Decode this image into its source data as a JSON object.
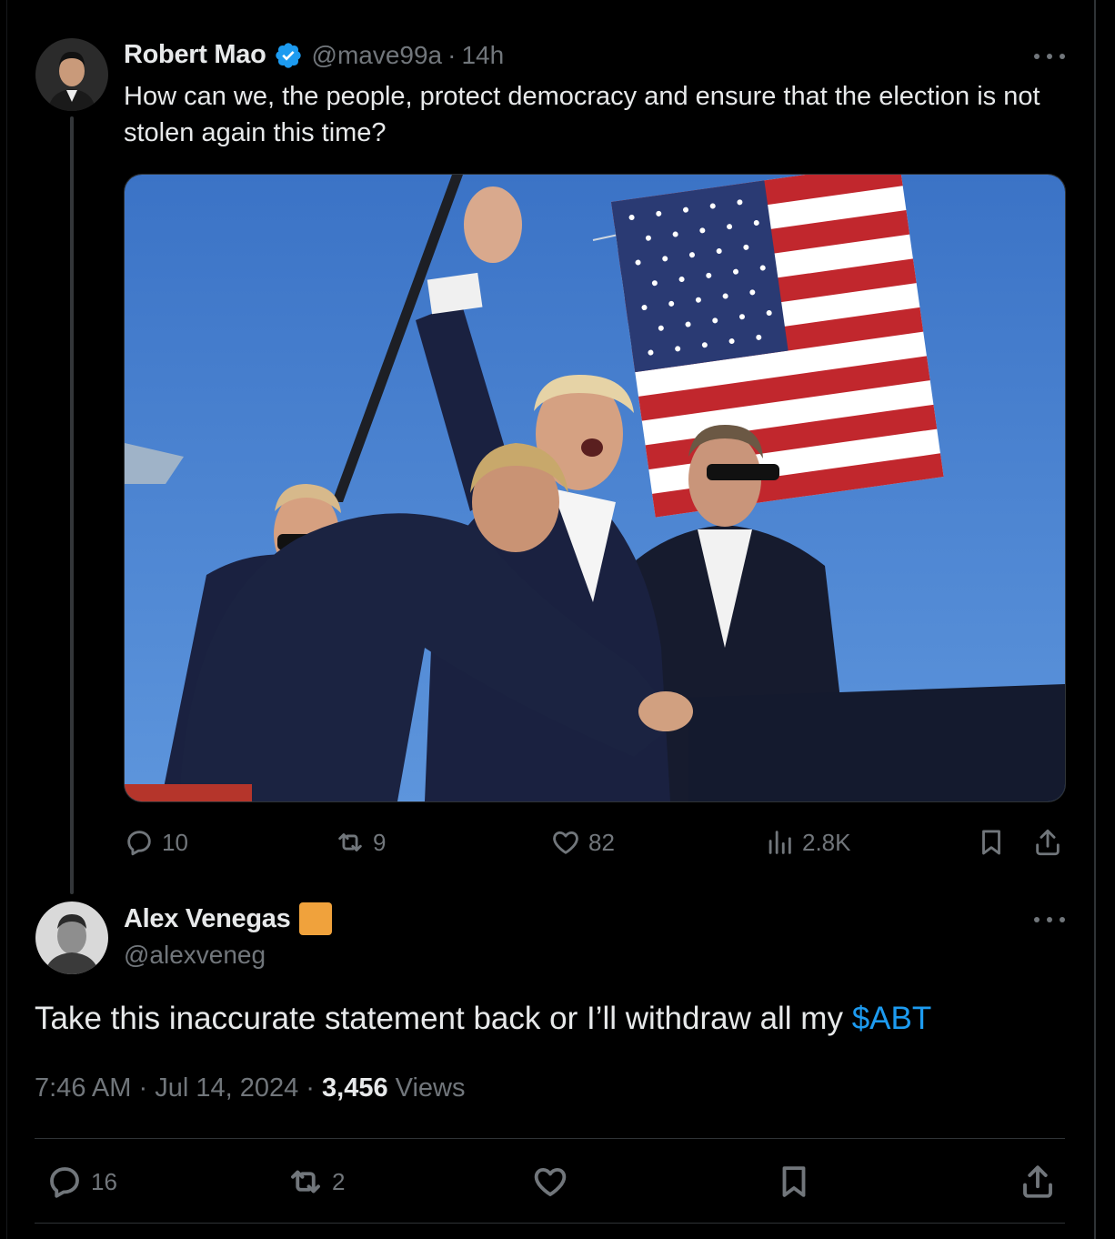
{
  "parent": {
    "author_name": "Robert Mao",
    "handle": "@mave99a",
    "separator": "·",
    "age": "14h",
    "text": "How can we, the people, protect democracy and ensure that the election is not stolen again this time?",
    "media_alt_icon": "photo",
    "stats": {
      "replies": "10",
      "reposts": "9",
      "likes": "82",
      "views": "2.8K"
    }
  },
  "reply": {
    "author_name": "Alex Venegas",
    "badge_color": "#f0a23c",
    "handle": "@alexveneg",
    "text_before": "Take this inaccurate statement back or I’ll withdraw all my ",
    "cashtag": "$ABT",
    "time": "7:46 AM",
    "separator": "·",
    "date": "Jul 14, 2024",
    "views_count": "3,456",
    "views_label": "Views",
    "stats": {
      "replies": "16",
      "reposts": "2"
    }
  },
  "colors": {
    "background": "#000000",
    "text": "#e7e9ea",
    "muted": "#71767b",
    "accent": "#1d9bf0",
    "verified": "#1d9bf0"
  }
}
